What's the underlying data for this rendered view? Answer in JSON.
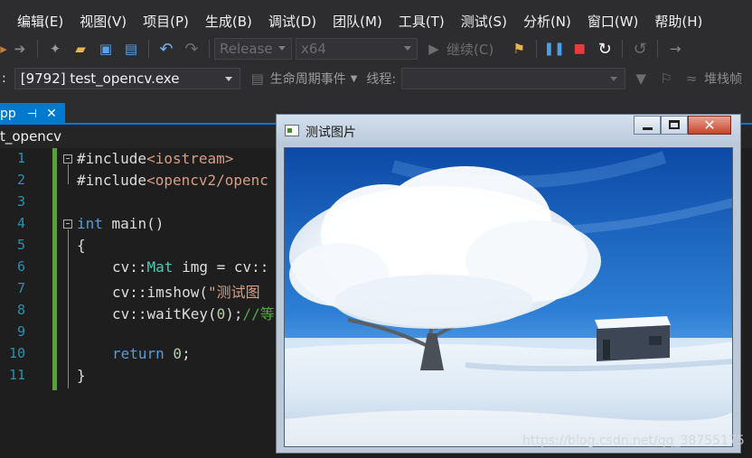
{
  "menu": [
    "编辑(E)",
    "视图(V)",
    "项目(P)",
    "生成(B)",
    "调试(D)",
    "团队(M)",
    "工具(T)",
    "测试(S)",
    "分析(N)",
    "窗口(W)",
    "帮助(H)"
  ],
  "toolbar": {
    "configuration": "Release",
    "platform": "x64",
    "continue_label": "继续(C)"
  },
  "debug": {
    "prefix": ":",
    "process": "[9792] test_opencv.exe",
    "lifecycle_label": "生命周期事件",
    "thread_label": "线程:",
    "stack_label": "堆栈帧"
  },
  "tab": {
    "name": "pp",
    "pin": "⊣",
    "close": "✕"
  },
  "navbar": {
    "project": "t_opencv"
  },
  "code": {
    "line_numbers": [
      "1",
      "2",
      "3",
      "4",
      "5",
      "6",
      "7",
      "8",
      "9",
      "10",
      "11"
    ],
    "l1_prefix": "#include",
    "l1_include": "<iostream>",
    "l2_prefix": "#include",
    "l2_include": "<opencv2/openc",
    "l4_kw": "int",
    "l4_rest": " main()",
    "l5": "{",
    "l6_a": "cv::",
    "l6_type": "Mat",
    "l6_b": " img = cv::",
    "l7_a": "cv::imshow(",
    "l7_str": "\"测试图",
    "l8_a": "cv::waitKey(",
    "l8_num": "0",
    "l8_b": ");",
    "l8_cm": "//等",
    "l10_kw": "return",
    "l10_num": " 0",
    "l10_b": ";",
    "l11": "}"
  },
  "image_window": {
    "title": "测试图片",
    "close_glyph": "✕"
  },
  "watermark": "https://blog.csdn.net/qq_38755175",
  "colors": {
    "accent": "#007acc",
    "change_bar": "#5c9e3e",
    "line_number": "#2b91af",
    "keyword": "#569cd6",
    "type": "#4ec9b0",
    "string": "#d69d85",
    "comment": "#57a64a"
  }
}
